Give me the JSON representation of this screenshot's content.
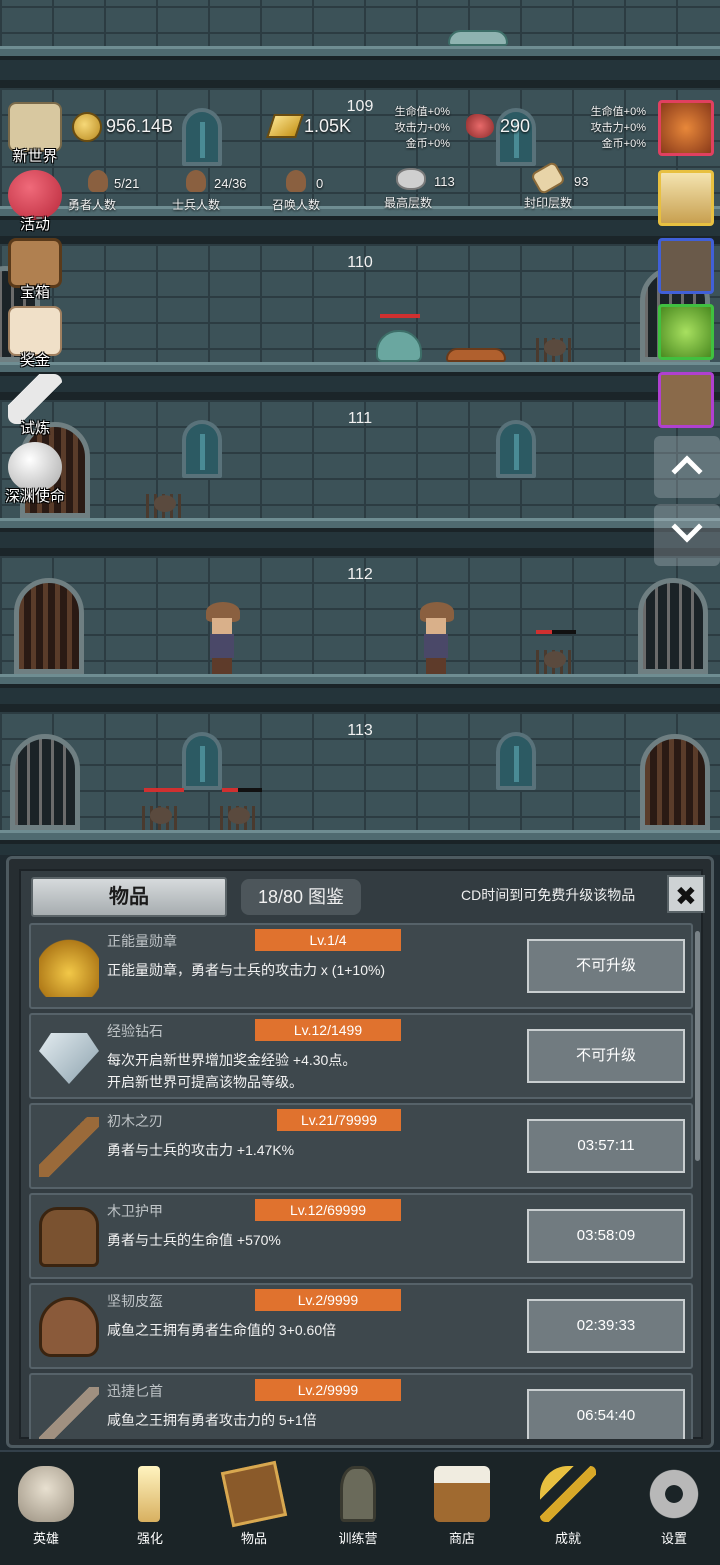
{
  "floors": [
    {
      "number": ""
    },
    {
      "number": "109"
    },
    {
      "number": "110"
    },
    {
      "number": "111"
    },
    {
      "number": "112"
    },
    {
      "number": "113"
    }
  ],
  "resources": {
    "coins": "956.14B",
    "gold": "1.05K",
    "meat": "290",
    "bonus_left": [
      "生命值+0%",
      "攻击力+0%",
      "金币+0%"
    ],
    "bonus_right": [
      "生命值+0%",
      "攻击力+0%",
      "金币+0%"
    ]
  },
  "stats": {
    "heroes": {
      "value": "5/21",
      "label": "勇者人数"
    },
    "soldiers": {
      "value": "24/36",
      "label": "士兵人数"
    },
    "summons": {
      "value": "0",
      "label": "召唤人数"
    },
    "top_floor": {
      "value": "113",
      "label": "最高层数"
    },
    "sealed_floor": {
      "value": "93",
      "label": "封印层数"
    }
  },
  "left_menu": [
    {
      "label": "新世界",
      "icon": "map-icon"
    },
    {
      "label": "活动",
      "icon": "heart-icon"
    },
    {
      "label": "宝箱",
      "icon": "chest-icon"
    },
    {
      "label": "奖金",
      "icon": "envelope-icon"
    },
    {
      "label": "试炼",
      "icon": "feather-icon"
    },
    {
      "label": "深渊使命",
      "icon": "pearl-icon"
    }
  ],
  "right_boosts": [
    "apple-icon",
    "candle-icon",
    "portrait-icon",
    "slime-icon",
    "hero-portrait-icon"
  ],
  "panel": {
    "title": "物品",
    "dex": "18/80 图鉴",
    "note": "CD时间到可免费升级该物品",
    "close": "✖"
  },
  "items": [
    {
      "name": "正能量勋章",
      "level": "Lv.1/4",
      "desc": "正能量勋章，勇者与士兵的攻击力 x (1+10%)",
      "desc2": "",
      "button": "不可升级",
      "icon": "crown-icon"
    },
    {
      "name": "经验钻石",
      "level": "Lv.12/1499",
      "desc": "每次开启新世界增加奖金经验 +4.30点。",
      "desc2": "开启新世界可提高该物品等级。",
      "button": "不可升级",
      "icon": "diamond-icon"
    },
    {
      "name": "初木之刃",
      "level": "Lv.21/79999",
      "desc": "勇者与士兵的攻击力 +1.47K%",
      "desc2": "",
      "button": "03:57:11",
      "icon": "sword-icon"
    },
    {
      "name": "木卫护甲",
      "level": "Lv.12/69999",
      "desc": "勇者与士兵的生命值 +570%",
      "desc2": "",
      "button": "03:58:09",
      "icon": "armor-icon"
    },
    {
      "name": "坚韧皮盔",
      "level": "Lv.2/9999",
      "desc": "咸鱼之王拥有勇者生命值的 3+0.60倍",
      "desc2": "",
      "button": "02:39:33",
      "icon": "helmet-icon"
    },
    {
      "name": "迅捷匕首",
      "level": "Lv.2/9999",
      "desc": "咸鱼之王拥有勇者攻击力的 5+1倍",
      "desc2": "",
      "button": "06:54:40",
      "icon": "dagger-icon"
    }
  ],
  "nav": [
    {
      "label": "英雄",
      "icon": "skull-icon"
    },
    {
      "label": "强化",
      "icon": "candle-icon"
    },
    {
      "label": "物品",
      "icon": "book-icon"
    },
    {
      "label": "训练营",
      "icon": "lantern-icon"
    },
    {
      "label": "商店",
      "icon": "mug-icon"
    },
    {
      "label": "成就",
      "icon": "key-icon"
    },
    {
      "label": "设置",
      "icon": "gear-icon"
    }
  ],
  "colors": {
    "level_badge": "#e0722e",
    "panel_bg": "#333c41",
    "row_bg": "#3e484d"
  }
}
